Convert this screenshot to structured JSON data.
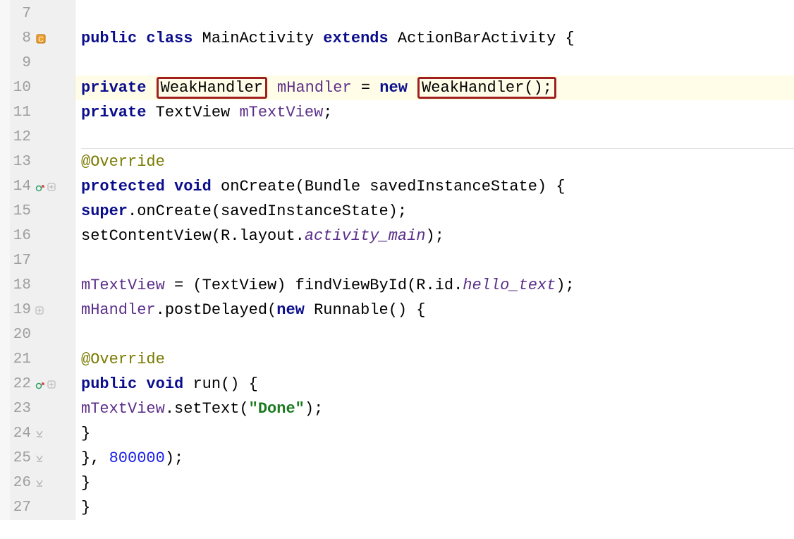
{
  "lines": [
    {
      "n": 7,
      "indent": 0,
      "parts": []
    },
    {
      "n": 8,
      "indent": 0,
      "icons": [
        "class"
      ],
      "parts": [
        {
          "t": "public ",
          "c": "kw"
        },
        {
          "t": "class ",
          "c": "kw"
        },
        {
          "t": "MainActivity ",
          "c": "type"
        },
        {
          "t": "extends ",
          "c": "kw"
        },
        {
          "t": "ActionBarActivity {",
          "c": "type"
        }
      ]
    },
    {
      "n": 9,
      "indent": 0,
      "parts": []
    },
    {
      "n": 10,
      "indent": 1,
      "hl": true,
      "parts": [
        {
          "t": "private ",
          "c": "kw"
        },
        {
          "t": "WeakHandler",
          "c": "type",
          "box": true
        },
        {
          "t": " mHandler",
          "c": "field"
        },
        {
          "t": " = ",
          "c": ""
        },
        {
          "t": "new ",
          "c": "kw"
        },
        {
          "t": "WeakHandler();",
          "c": "type",
          "box": true
        }
      ]
    },
    {
      "n": 11,
      "indent": 1,
      "parts": [
        {
          "t": "private ",
          "c": "kw"
        },
        {
          "t": "TextView ",
          "c": "type"
        },
        {
          "t": "mTextView",
          "c": "field"
        },
        {
          "t": ";",
          "c": ""
        }
      ]
    },
    {
      "n": 12,
      "indent": 0,
      "parts": []
    },
    {
      "n": 13,
      "indent": 1,
      "parts": [
        {
          "t": "@Override",
          "c": "ann"
        }
      ]
    },
    {
      "n": 14,
      "indent": 1,
      "icons": [
        "override",
        "fold"
      ],
      "parts": [
        {
          "t": "protected ",
          "c": "kw"
        },
        {
          "t": "void ",
          "c": "kw"
        },
        {
          "t": "onCreate(Bundle savedInstanceState) {",
          "c": "fn"
        }
      ]
    },
    {
      "n": 15,
      "indent": 2,
      "parts": [
        {
          "t": "super",
          "c": "kw"
        },
        {
          "t": ".onCreate(savedInstanceState);",
          "c": ""
        }
      ]
    },
    {
      "n": 16,
      "indent": 2,
      "parts": [
        {
          "t": "setContentView(R.layout.",
          "c": ""
        },
        {
          "t": "activity_main",
          "c": "it"
        },
        {
          "t": ");",
          "c": ""
        }
      ]
    },
    {
      "n": 17,
      "indent": 0,
      "parts": []
    },
    {
      "n": 18,
      "indent": 2,
      "parts": [
        {
          "t": "mTextView",
          "c": "field"
        },
        {
          "t": " = (TextView) findViewById(R.id.",
          "c": ""
        },
        {
          "t": "hello_text",
          "c": "it"
        },
        {
          "t": ");",
          "c": ""
        }
      ]
    },
    {
      "n": 19,
      "indent": 2,
      "icons": [
        "fold"
      ],
      "parts": [
        {
          "t": "mHandler",
          "c": "field"
        },
        {
          "t": ".postDelayed(",
          "c": ""
        },
        {
          "t": "new ",
          "c": "kw"
        },
        {
          "t": "Runnable() {",
          "c": "type"
        }
      ]
    },
    {
      "n": 20,
      "indent": 0,
      "parts": []
    },
    {
      "n": 21,
      "indent": 3,
      "parts": [
        {
          "t": "@Override",
          "c": "ann"
        }
      ]
    },
    {
      "n": 22,
      "indent": 3,
      "icons": [
        "override",
        "fold"
      ],
      "parts": [
        {
          "t": "public ",
          "c": "kw"
        },
        {
          "t": "void ",
          "c": "kw"
        },
        {
          "t": "run() {",
          "c": "fn"
        }
      ]
    },
    {
      "n": 23,
      "indent": 4,
      "parts": [
        {
          "t": "mTextView",
          "c": "field"
        },
        {
          "t": ".setText(",
          "c": ""
        },
        {
          "t": "\"Done\"",
          "c": "str"
        },
        {
          "t": ");",
          "c": ""
        }
      ]
    },
    {
      "n": 24,
      "indent": 3,
      "icons": [
        "unfold"
      ],
      "parts": [
        {
          "t": "}",
          "c": ""
        }
      ]
    },
    {
      "n": 25,
      "indent": 2,
      "icons": [
        "unfold"
      ],
      "parts": [
        {
          "t": "}, ",
          "c": ""
        },
        {
          "t": "800000",
          "c": "num"
        },
        {
          "t": ");",
          "c": ""
        }
      ]
    },
    {
      "n": 26,
      "indent": 1,
      "icons": [
        "unfold"
      ],
      "parts": [
        {
          "t": "}",
          "c": ""
        }
      ]
    },
    {
      "n": 27,
      "indent": 0,
      "parts": [
        {
          "t": "}",
          "c": ""
        }
      ]
    }
  ],
  "indent_unit": "    "
}
